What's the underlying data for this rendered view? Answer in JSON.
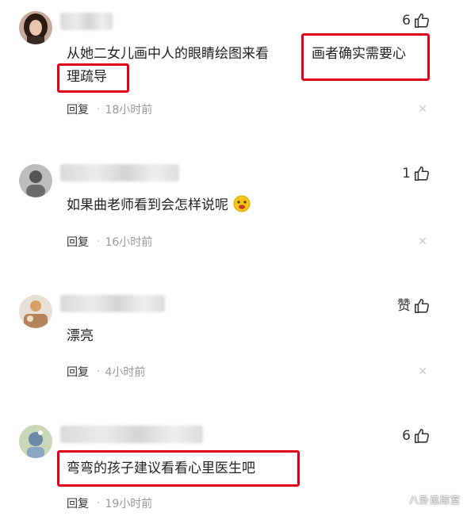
{
  "comments": [
    {
      "likes": "6",
      "lines": [
        "从她二女儿画中人的眼睛绘图来看",
        "画者确实需要心",
        "理疏导"
      ],
      "reply": "回复",
      "time": "18小时前"
    },
    {
      "likes": "1",
      "lines": [
        "如果曲老师看到会怎样说呢"
      ],
      "reply": "回复",
      "time": "16小时前"
    },
    {
      "likes": "赞",
      "lines": [
        "漂亮"
      ],
      "reply": "回复",
      "time": "4小时前"
    },
    {
      "likes": "6",
      "lines": [
        "弯弯的孩子建议看看心里医生吧"
      ],
      "reply": "回复",
      "time": "19小时前"
    }
  ],
  "icons": {
    "like": "thumbs-up-icon",
    "close": "close-icon",
    "emoji": "emoji-icon"
  },
  "colors": {
    "highlight": "#e0001b"
  },
  "watermark": "八卦追踪室"
}
